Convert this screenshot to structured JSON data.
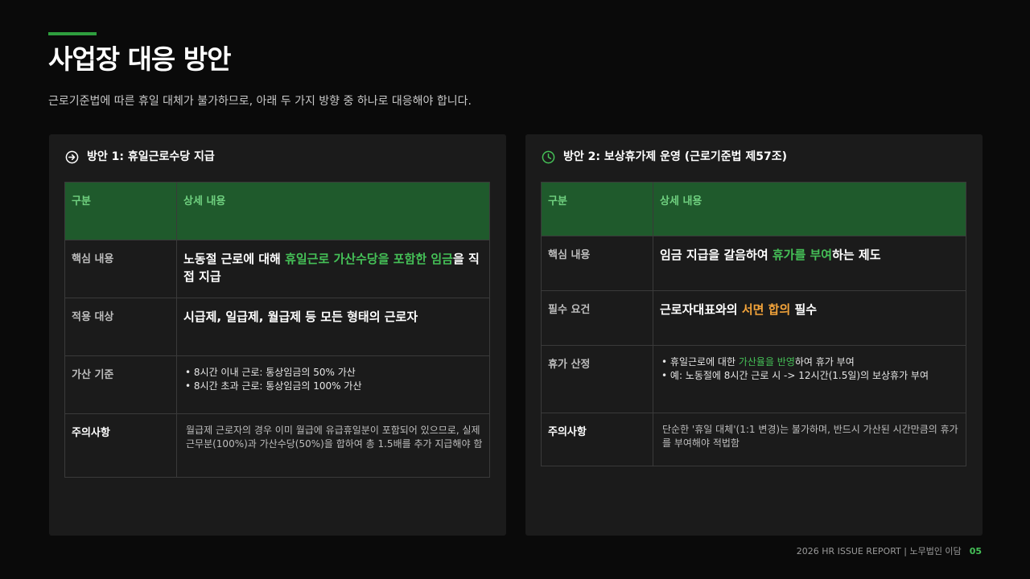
{
  "title": "사업장 대응 방안",
  "subtitle": "근로기준법에 따른 휴일 대체가 불가하므로, 아래 두 가지 방향 중 하나로 대응해야 합니다.",
  "accent_color": "#2e9e3e",
  "left": {
    "icon": "arrow-circle-right-icon",
    "heading": "방안 1: 휴일근로수당 지급",
    "col1": "구분",
    "col2": "상세 내용",
    "rows": {
      "core": {
        "label": "핵심 내용",
        "pre": "노동절 근로에 대해 ",
        "highlight": "휴일근로 가산수당을 포함한 임금",
        "post": "을 직접 지급"
      },
      "scope": {
        "label": "적용 대상",
        "text": "시급제, 일급제, 월급제 등 모든 형태의 근로자"
      },
      "rate": {
        "label": "가산 기준",
        "items": [
          "8시간 이내 근로: 통상임금의 50% 가산",
          "8시간 초과 근로: 통상임금의 100% 가산"
        ]
      },
      "caution": {
        "label": "주의사항",
        "text": "월급제 근로자의 경우 이미 월급에 유급휴일분이 포함되어 있으므로, 실제 근무분(100%)과 가산수당(50%)을 합하여 총 1.5배를 추가 지급해야 함"
      }
    }
  },
  "right": {
    "icon": "clock-icon",
    "heading": "방안 2: 보상휴가제 운영 (근로기준법 제57조)",
    "col1": "구분",
    "col2": "상세 내용",
    "rows": {
      "core": {
        "label": "핵심 내용",
        "pre": "임금 지급을 갈음하여 ",
        "highlight": "휴가를 부여",
        "post": "하는 제도"
      },
      "req": {
        "label": "필수 요건",
        "pre": "근로자대표와의 ",
        "highlight": "서면 합의",
        "post": " 필수"
      },
      "calc": {
        "label": "휴가 산정",
        "item1_pre": "휴일근로에 대한 ",
        "item1_highlight": "가산율을 반영",
        "item1_post": "하여 휴가 부여",
        "item2": "예: 노동절에 8시간 근로 시 -> 12시간(1.5일)의 보상휴가 부여"
      },
      "caution": {
        "label": "주의사항",
        "text": "단순한 '휴일 대체'(1:1 변경)는 불가하며, 반드시 가산된 시간만큼의 휴가를 부여해야 적법함"
      }
    }
  },
  "footer": {
    "text": "2026 HR ISSUE REPORT | 노무법인 이담",
    "page": "05"
  }
}
